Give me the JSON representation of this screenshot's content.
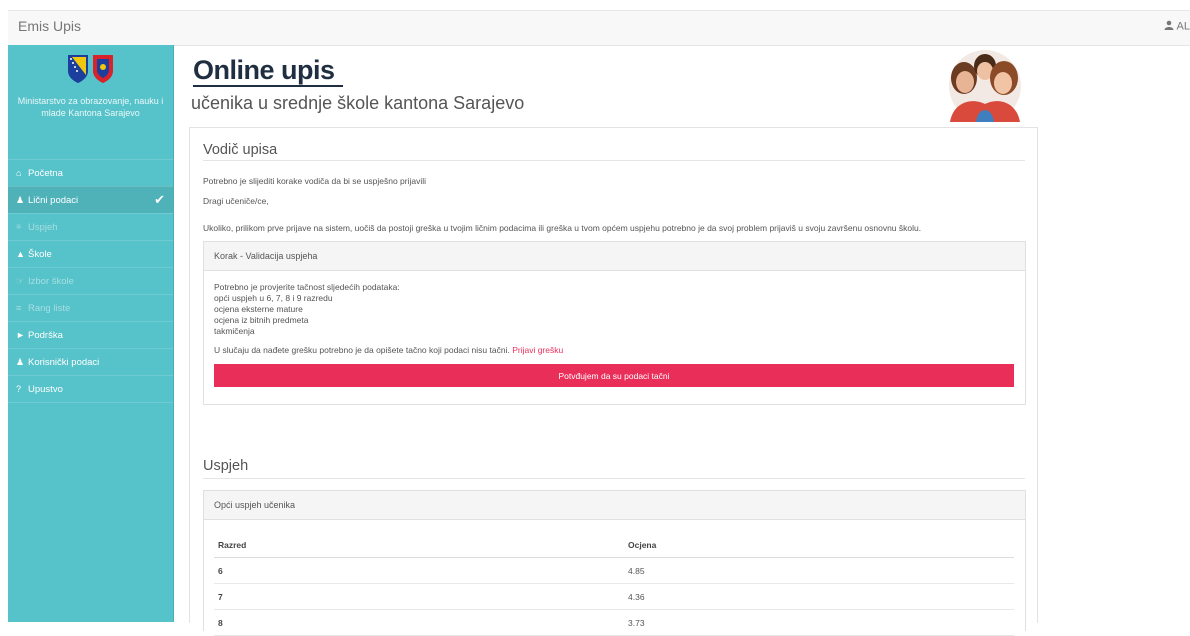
{
  "topbar": {
    "brand": "Emis Upis",
    "user": "AL"
  },
  "sidebar": {
    "ministry": "Ministarstvo za obrazovanje, nauku i mlade Kantona Sarajevo",
    "items": [
      {
        "label": "Početna",
        "icon": "home-icon",
        "state": "enabled"
      },
      {
        "label": "Lični podaci",
        "icon": "user-icon",
        "state": "active",
        "checked": true
      },
      {
        "label": "Uspjeh",
        "icon": "trophy-icon",
        "state": "disabled"
      },
      {
        "label": "Škole",
        "icon": "graduation-cap-icon",
        "state": "enabled"
      },
      {
        "label": "Izbor škole",
        "icon": "thumbs-up-icon",
        "state": "disabled"
      },
      {
        "label": "Rang liste",
        "icon": "list-icon",
        "state": "disabled"
      },
      {
        "label": "Podrška",
        "icon": "bullhorn-icon",
        "state": "enabled"
      },
      {
        "label": "Korisnički podaci",
        "icon": "user-icon",
        "state": "enabled"
      },
      {
        "label": "Upustvo",
        "icon": "question-icon",
        "state": "enabled"
      }
    ]
  },
  "header": {
    "title": "Online upis",
    "subtitle": "učenika u srednje škole kantona Sarajevo"
  },
  "guide": {
    "title": "Vodič upisa",
    "intro": "Potrebno je slijediti korake vodiča da bi se uspješno prijavili",
    "greeting": "Dragi učeniče/ce,",
    "notice": "Ukoliko, prilikom prve prijave na sistem, uočiš da postoji greška u tvojim ličnim podacima ili greška u tvom općem uspjehu potrebno je da svoj problem prijaviš u svoju završenu osnovnu školu.",
    "step": {
      "heading": "Korak - Validacija uspjeha",
      "lines": [
        "Potrebno je provjerite tačnost sljedećih podataka:",
        "opći uspjeh u 6, 7, 8 i 9 razredu",
        "ocjena eksterne mature",
        "ocjena iz bitnih predmeta",
        "takmičenja"
      ],
      "error_text": "U slučaju da nađete grešku potrebno je da opišete tačno koji podaci nisu tačni.",
      "error_link": "Prijavi grešku",
      "confirm_label": "Potvđujem da su podaci tačni"
    }
  },
  "success": {
    "title": "Uspjeh",
    "panel_heading": "Opći uspjeh učenika",
    "columns": [
      "Razred",
      "Ocjena"
    ],
    "rows": [
      {
        "razred": "6",
        "ocjena": "4.85"
      },
      {
        "razred": "7",
        "ocjena": "4.36"
      },
      {
        "razred": "8",
        "ocjena": "3.73"
      }
    ]
  },
  "colors": {
    "sidebar": "#56c2c9",
    "accent": "#ea2e5a",
    "title": "#1f2e40"
  }
}
